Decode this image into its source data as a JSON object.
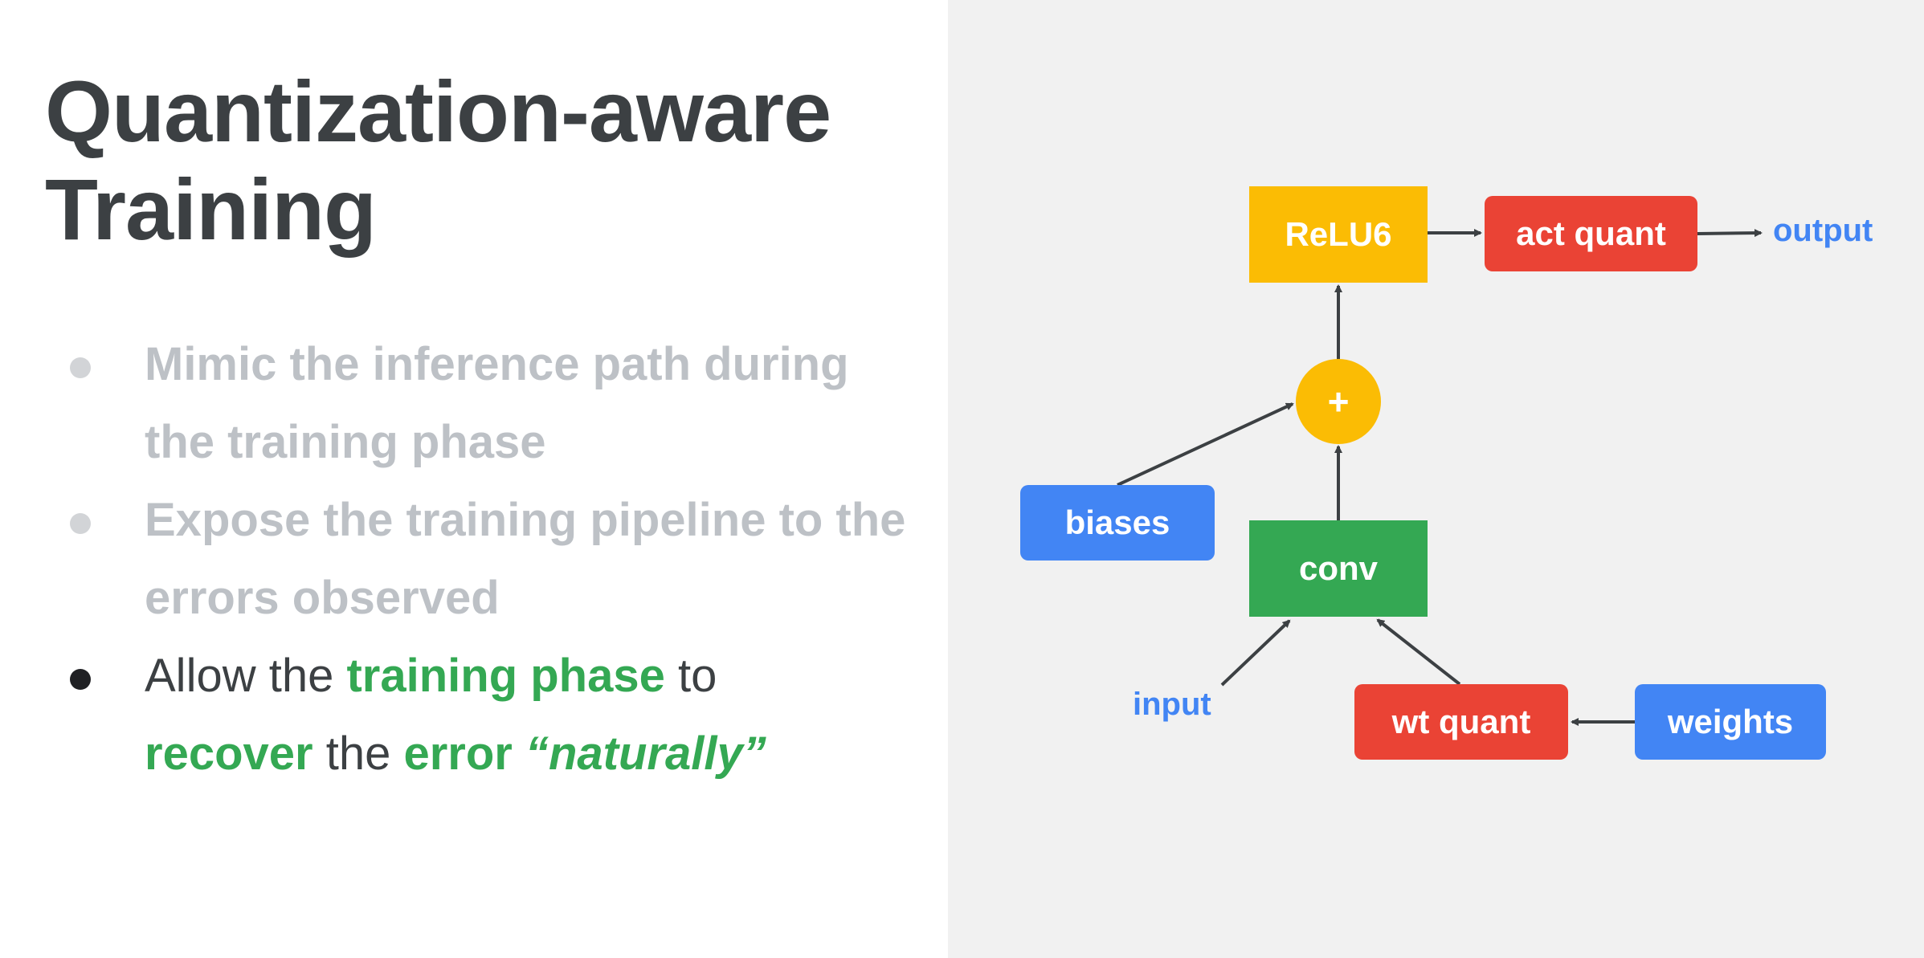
{
  "title": {
    "line1": "Quantization-aware",
    "line2": "Training"
  },
  "bullets": [
    {
      "text": "Mimic the inference path during the training phase"
    },
    {
      "text": "Expose the training pipeline to the errors observed"
    },
    {
      "part1": "Allow the ",
      "hl1": "training phase",
      "part2": " to ",
      "hl2": "recover",
      "part3": " the ",
      "hl3": "error",
      "hl4": "“naturally”"
    }
  ],
  "diagram": {
    "relu6": "ReLU6",
    "act_quant": "act quant",
    "output": "output",
    "plus": "+",
    "biases": "biases",
    "conv": "conv",
    "input": "input",
    "wt_quant": "wt quant",
    "weights": "weights"
  },
  "colors": {
    "yellow": "#fbbc04",
    "red": "#ea4335",
    "green": "#34a853",
    "blue": "#4285f4",
    "text_dark": "#3c4043",
    "text_faded": "#bdc1c6",
    "panel_bg": "#f1f1f1"
  }
}
